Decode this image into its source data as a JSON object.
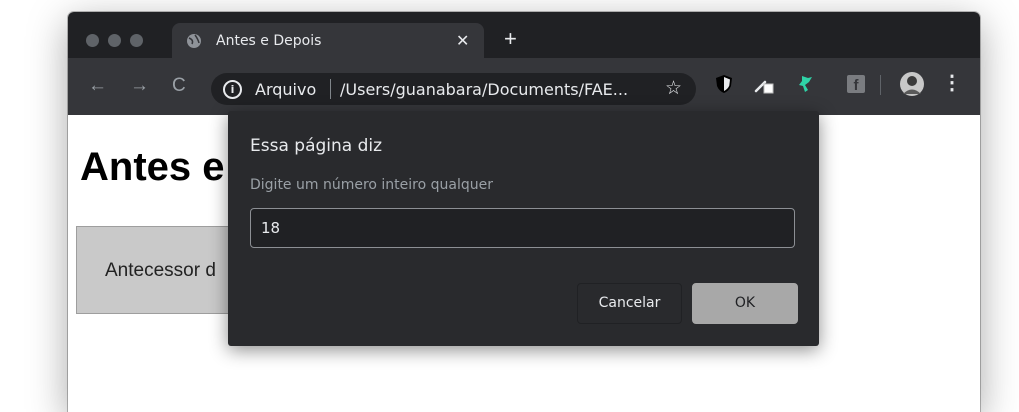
{
  "browser": {
    "tab": {
      "title": "Antes e Depois",
      "close_glyph": "✕"
    },
    "new_tab_glyph": "+",
    "nav": {
      "back_glyph": "←",
      "forward_glyph": "→",
      "reload_glyph": "C"
    },
    "omnibox": {
      "info_glyph": "i",
      "scheme_label": "Arquivo",
      "url": "/Users/guanabara/Documents/FAE...",
      "bookmark_glyph": "☆"
    },
    "extensions": [
      "shield-icon",
      "eyedropper-icon",
      "green-extension-icon",
      "facebook-icon",
      "profile-avatar-icon"
    ],
    "extension_glyphs": {
      "facebook": "f"
    },
    "menu_glyph": "⋮"
  },
  "page": {
    "heading": "Antes e",
    "box_text": "Antecessor d"
  },
  "dialog": {
    "title": "Essa página diz",
    "message": "Digite um número inteiro qualquer",
    "input_value": "18",
    "cancel_label": "Cancelar",
    "ok_label": "OK"
  },
  "colors": {
    "tabbar_bg": "#202124",
    "toolbar_bg": "#35363a",
    "dialog_bg": "#292a2d",
    "ok_button": "#a8a8a8"
  }
}
